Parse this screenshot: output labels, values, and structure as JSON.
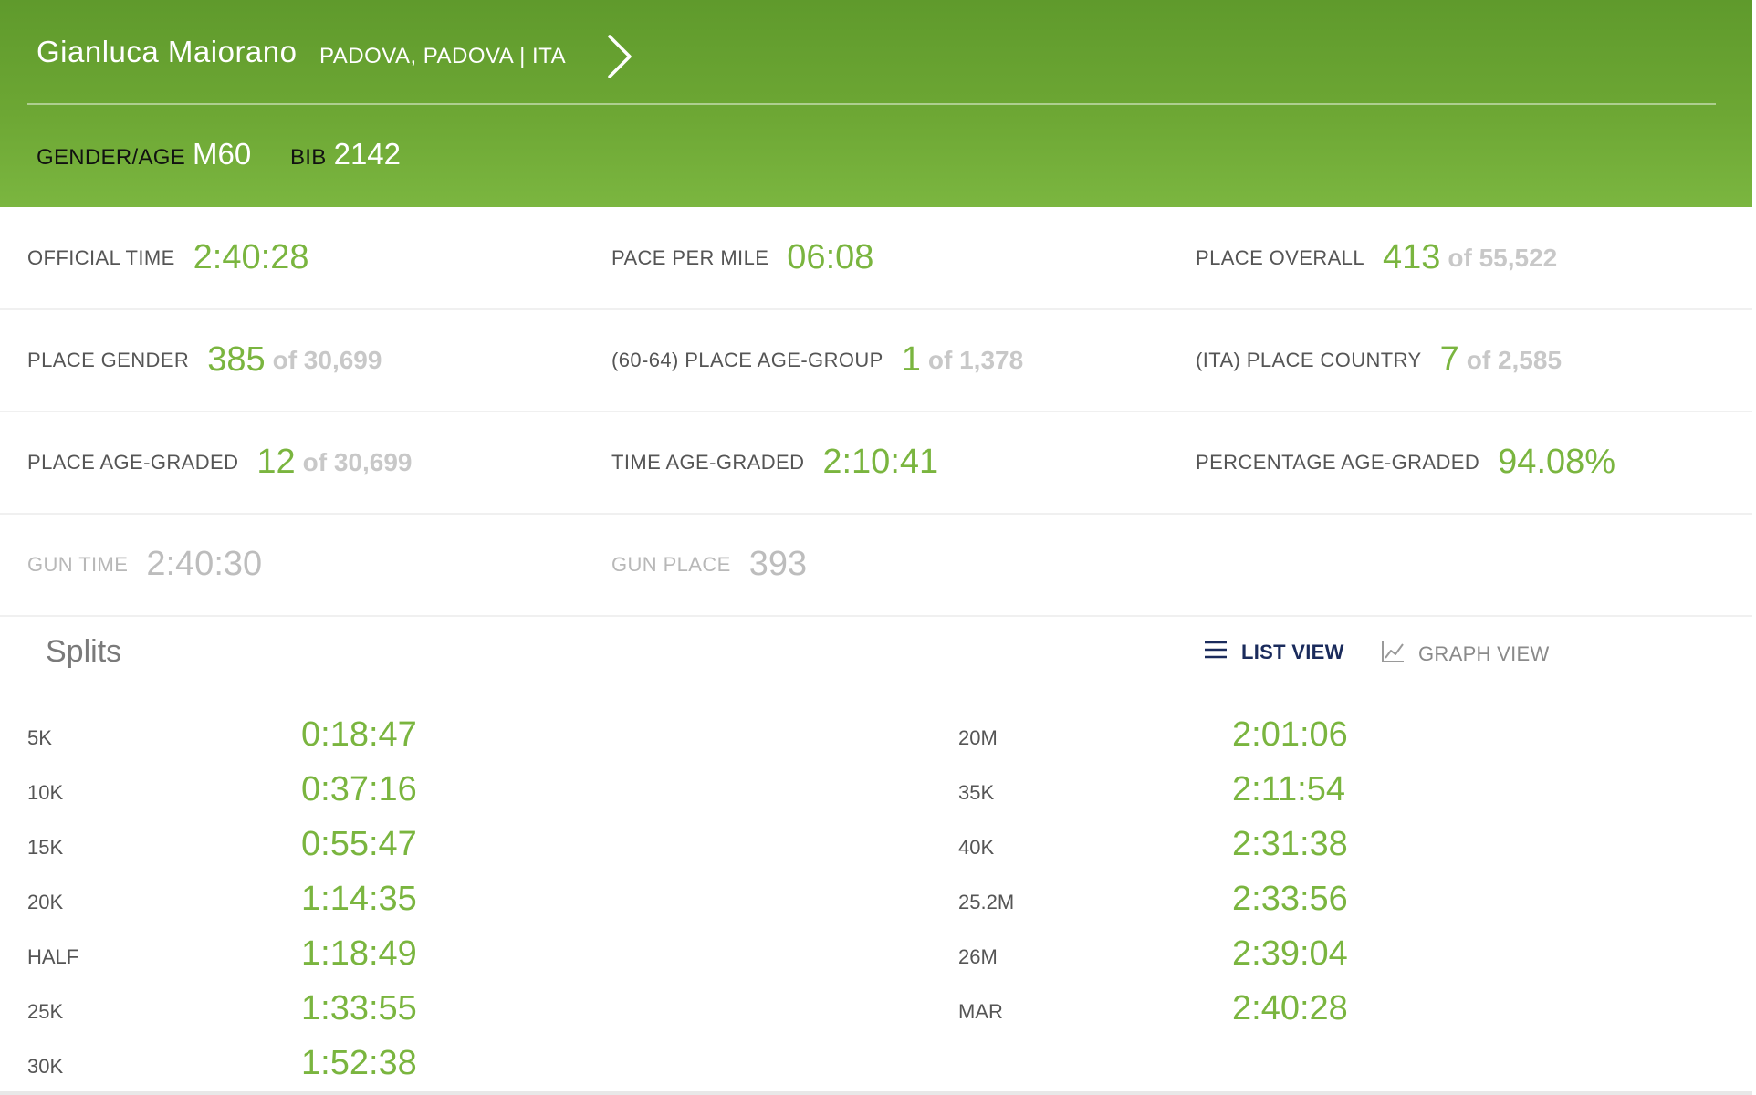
{
  "header": {
    "name": "Gianluca Maiorano",
    "location": "PADOVA, PADOVA | ITA",
    "gender_age_label": "GENDER/AGE",
    "gender_age_value": "M60",
    "bib_label": "BIB",
    "bib_value": "2142"
  },
  "stats": {
    "official_time": {
      "label": "OFFICIAL TIME",
      "value": "2:40:28"
    },
    "pace_per_mile": {
      "label": "PACE PER MILE",
      "value": "06:08"
    },
    "place_overall": {
      "label": "PLACE OVERALL",
      "value": "413",
      "of": "of 55,522"
    },
    "place_gender": {
      "label": "PLACE GENDER",
      "value": "385",
      "of": "of 30,699"
    },
    "place_age_group": {
      "label": "(60-64) PLACE AGE-GROUP",
      "value": "1",
      "of": "of 1,378"
    },
    "place_country": {
      "label": "(ITA) PLACE COUNTRY",
      "value": "7",
      "of": "of 2,585"
    },
    "place_age_graded": {
      "label": "PLACE AGE-GRADED",
      "value": "12",
      "of": "of 30,699"
    },
    "time_age_graded": {
      "label": "TIME AGE-GRADED",
      "value": "2:10:41"
    },
    "percentage_age_graded": {
      "label": "PERCENTAGE AGE-GRADED",
      "value": "94.08%"
    },
    "gun_time": {
      "label": "GUN TIME",
      "value": "2:40:30"
    },
    "gun_place": {
      "label": "GUN PLACE",
      "value": "393"
    }
  },
  "splits": {
    "title": "Splits",
    "list_view_label": "LIST VIEW",
    "graph_view_label": "GRAPH VIEW",
    "left": [
      {
        "label": "5K",
        "time": "0:18:47"
      },
      {
        "label": "10K",
        "time": "0:37:16"
      },
      {
        "label": "15K",
        "time": "0:55:47"
      },
      {
        "label": "20K",
        "time": "1:14:35"
      },
      {
        "label": "HALF",
        "time": "1:18:49"
      },
      {
        "label": "25K",
        "time": "1:33:55"
      },
      {
        "label": "30K",
        "time": "1:52:38"
      }
    ],
    "right": [
      {
        "label": "20M",
        "time": "2:01:06"
      },
      {
        "label": "35K",
        "time": "2:11:54"
      },
      {
        "label": "40K",
        "time": "2:31:38"
      },
      {
        "label": "25.2M",
        "time": "2:33:56"
      },
      {
        "label": "26M",
        "time": "2:39:04"
      },
      {
        "label": "MAR",
        "time": "2:40:28"
      }
    ]
  },
  "colors": {
    "header_green": "#6da734",
    "value_green": "#7ab53f",
    "of_gray": "#c8c8c8",
    "list_view_navy": "#1a2b5c"
  },
  "icons": {
    "next": "chevron-right-icon",
    "list_view": "list-icon",
    "graph_view": "line-chart-icon"
  }
}
